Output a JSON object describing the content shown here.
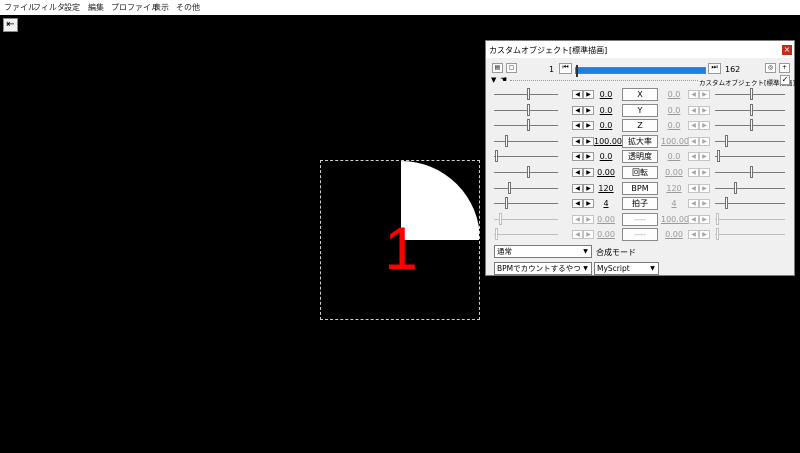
{
  "menu": [
    "ファイル",
    "フィルタ",
    "設定",
    "編集",
    "プロファイル",
    "表示",
    "その他"
  ],
  "back_icon": "back-arrow-icon",
  "preview": {
    "number": "1",
    "number_color": "#ff0000"
  },
  "dialog": {
    "title": "カスタムオブジェクト[標準描画]",
    "frame_start": "1",
    "frame_end": "162",
    "object_label": "カスタムオブジェクト[標準描画]",
    "accent_color": "#1e7fe0",
    "params": [
      {
        "name": "X",
        "left": "0.0",
        "right": "0.0",
        "enabled": true
      },
      {
        "name": "Y",
        "left": "0.0",
        "right": "0.0",
        "enabled": true
      },
      {
        "name": "Z",
        "left": "0.0",
        "right": "0.0",
        "enabled": true
      },
      {
        "name": "拡大率",
        "left": "100.00",
        "right": "100.00",
        "enabled": true
      },
      {
        "name": "透明度",
        "left": "0.0",
        "right": "0.0",
        "enabled": true
      },
      {
        "name": "回転",
        "left": "0.00",
        "right": "0.00",
        "enabled": true
      },
      {
        "name": "BPM",
        "left": "120",
        "right": "120",
        "enabled": true
      },
      {
        "name": "拍子",
        "left": "4",
        "right": "4",
        "enabled": true
      },
      {
        "name": "----",
        "left": "0.00",
        "right": "100.00",
        "enabled": false
      },
      {
        "name": "----",
        "left": "0.00",
        "right": "0.00",
        "enabled": false
      }
    ],
    "blend_select": "通常",
    "blend_label": "合成モード",
    "script_select": "BPMでカウントするやつ",
    "category_select": "MyScript"
  }
}
